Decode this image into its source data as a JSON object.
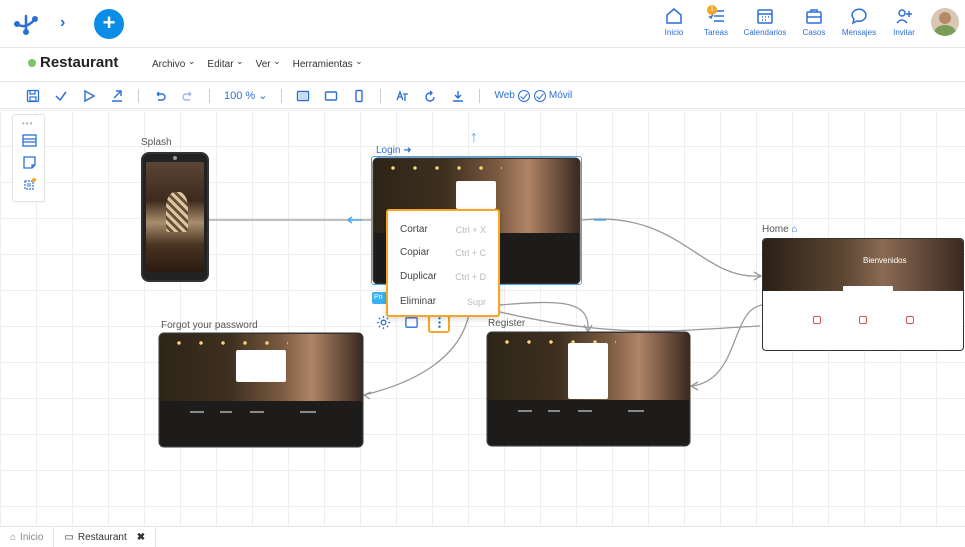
{
  "topnav": {
    "items": [
      {
        "label": "Inicio",
        "icon": "home-icon"
      },
      {
        "label": "Tareas",
        "icon": "tasks-icon",
        "badge": "1"
      },
      {
        "label": "Calendarios",
        "icon": "calendar-icon"
      },
      {
        "label": "Casos",
        "icon": "briefcase-icon"
      },
      {
        "label": "Mensajes",
        "icon": "chat-icon"
      },
      {
        "label": "Invitar",
        "icon": "add-user-icon"
      }
    ]
  },
  "app": {
    "title": "Restaurant",
    "status_color": "#7cc26b"
  },
  "menus": [
    "Archivo",
    "Editar",
    "Ver",
    "Herramientas"
  ],
  "toolbar": {
    "zoom": "100 %",
    "web_label": "Web",
    "mobile_label": "Móvil"
  },
  "canvas": {
    "nodes": {
      "splash": "Splash",
      "login": "Login",
      "home": "Home",
      "forgot": "Forgot your password",
      "register": "Register"
    },
    "home_welcome": "Bienvenidos"
  },
  "context_menu": {
    "items": [
      {
        "label": "Cortar",
        "shortcut": "Ctrl + X"
      },
      {
        "label": "Copiar",
        "shortcut": "Ctrl + C"
      },
      {
        "label": "Duplicar",
        "shortcut": "Ctrl + D"
      },
      {
        "label": "Eliminar",
        "shortcut": "Supr"
      }
    ]
  },
  "tabs": [
    {
      "label": "Inicio"
    },
    {
      "label": "Restaurant"
    }
  ],
  "colors": {
    "accent": "#2b6fd6",
    "highlight": "#f5a623",
    "selection": "#4aa5e8"
  }
}
